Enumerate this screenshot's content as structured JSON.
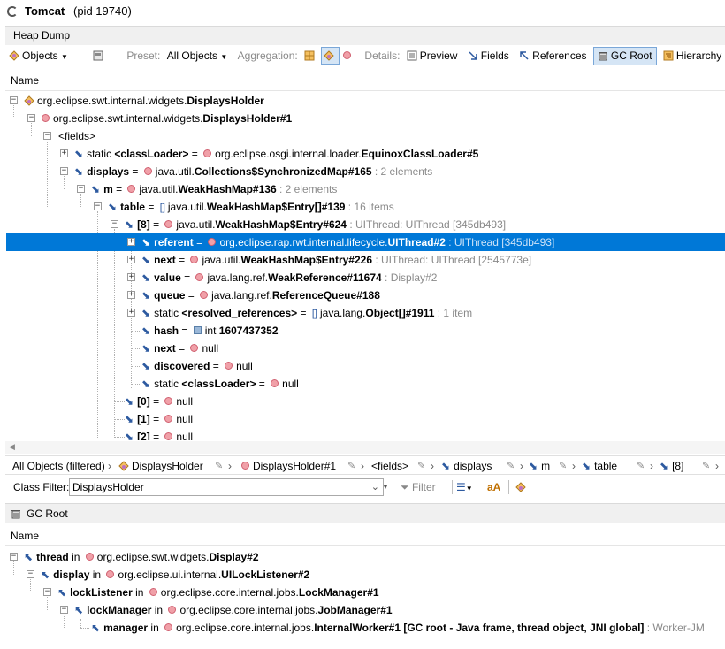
{
  "window": {
    "title": "Tomcat",
    "pid": "(pid 19740)"
  },
  "tab": {
    "label": "Heap Dump"
  },
  "toolbar": {
    "objects_label": "Objects",
    "preset_label": "Preset:",
    "preset_value": "All Objects",
    "aggregation_label": "Aggregation:",
    "details_label": "Details:",
    "preview": "Preview",
    "fields": "Fields",
    "references": "References",
    "gc_root": "GC Root",
    "hierarchy": "Hierarchy"
  },
  "tree": {
    "header": "Name",
    "rows": [
      {
        "pre": "org.eclipse.swt.internal.widgets.",
        "bold": "DisplaysHolder",
        "post": "",
        "gray": ""
      },
      {
        "pre": "org.eclipse.swt.internal.widgets.",
        "bold": "DisplaysHolder#1",
        "post": "",
        "gray": ""
      },
      {
        "pre": "<fields>",
        "bold": "",
        "post": "",
        "gray": ""
      },
      {
        "pre": "static ",
        "bold": "<classLoader>",
        "post": " = ",
        "val_pre": "org.eclipse.osgi.internal.loader.",
        "val_bold": "EquinoxClassLoader#5",
        "gray": ""
      },
      {
        "pre": "",
        "bold": "displays",
        "post": " = ",
        "val_pre": "java.util.",
        "val_bold": "Collections$SynchronizedMap#165",
        "gray": " : 2 elements"
      },
      {
        "pre": "",
        "bold": "m",
        "post": " = ",
        "val_pre": "java.util.",
        "val_bold": "WeakHashMap#136",
        "gray": " : 2 elements"
      },
      {
        "pre": "",
        "bold": "table",
        "post": " = ",
        "val_pre": "java.util.",
        "val_bold": "WeakHashMap$Entry[]#139",
        "gray": " : 16 items"
      },
      {
        "pre": "",
        "bold": "[8]",
        "post": " = ",
        "val_pre": "java.util.",
        "val_bold": "WeakHashMap$Entry#624",
        "gray": " : UIThread: UIThread [345db493]"
      },
      {
        "pre": "",
        "bold": "referent",
        "post": " = ",
        "val_pre": "org.eclipse.rap.rwt.internal.lifecycle.",
        "val_bold": "UIThread#2",
        "gray": " : UIThread [345db493]"
      },
      {
        "pre": "",
        "bold": "next",
        "post": " = ",
        "val_pre": "java.util.",
        "val_bold": "WeakHashMap$Entry#226",
        "gray": " : UIThread: UIThread [2545773e]"
      },
      {
        "pre": "",
        "bold": "value",
        "post": " = ",
        "val_pre": "java.lang.ref.",
        "val_bold": "WeakReference#11674",
        "gray": " : Display#2"
      },
      {
        "pre": "",
        "bold": "queue",
        "post": " = ",
        "val_pre": "java.lang.ref.",
        "val_bold": "ReferenceQueue#188",
        "gray": ""
      },
      {
        "pre": "static ",
        "bold": "<resolved_references>",
        "post": " = ",
        "val_pre": "java.lang.",
        "val_bold": "Object[]#1911",
        "gray": " : 1 item"
      },
      {
        "pre": "",
        "bold": "hash",
        "post": " = ",
        "val_pre": "int ",
        "val_bold": "1607437352",
        "gray": ""
      },
      {
        "pre": "",
        "bold": "next",
        "post": " = ",
        "val_pre": "null",
        "val_bold": "",
        "gray": ""
      },
      {
        "pre": "",
        "bold": "discovered",
        "post": " = ",
        "val_pre": "null",
        "val_bold": "",
        "gray": ""
      },
      {
        "pre": "static ",
        "bold": "<classLoader>",
        "post": " = ",
        "val_pre": "null",
        "val_bold": "",
        "gray": ""
      },
      {
        "pre": "",
        "bold": "[0]",
        "post": " = ",
        "val_pre": "null",
        "val_bold": "",
        "gray": ""
      },
      {
        "pre": "",
        "bold": "[1]",
        "post": " = ",
        "val_pre": "null",
        "val_bold": "",
        "gray": ""
      },
      {
        "pre": "",
        "bold": "[2]",
        "post": " = ",
        "val_pre": "null",
        "val_bold": "",
        "gray": ""
      }
    ]
  },
  "breadcrumb": {
    "items": [
      "All Objects (filtered)",
      "DisplaysHolder",
      "DisplaysHolder#1",
      "<fields>",
      "displays",
      "m",
      "table",
      "[8]"
    ]
  },
  "filter": {
    "label": "Class Filter:",
    "value": "DisplaysHolder",
    "filter_button": "Filter"
  },
  "gcroot": {
    "title": "GC Root",
    "header": "Name",
    "rows": [
      {
        "field": "thread",
        "in": " in ",
        "pre": "org.eclipse.swt.widgets.",
        "bold": "Display#2",
        "gray": ""
      },
      {
        "field": "display",
        "in": " in ",
        "pre": "org.eclipse.ui.internal.",
        "bold": "UILockListener#2",
        "gray": ""
      },
      {
        "field": "lockListener",
        "in": " in ",
        "pre": "org.eclipse.core.internal.jobs.",
        "bold": "LockManager#1",
        "gray": ""
      },
      {
        "field": "lockManager",
        "in": " in ",
        "pre": "org.eclipse.core.internal.jobs.",
        "bold": "JobManager#1",
        "gray": ""
      },
      {
        "field": "manager",
        "in": " in ",
        "pre": "org.eclipse.core.internal.jobs.",
        "bold": "InternalWorker#1 [GC root - Java frame, thread object, JNI global]",
        "gray": " : Worker-JM"
      }
    ]
  }
}
